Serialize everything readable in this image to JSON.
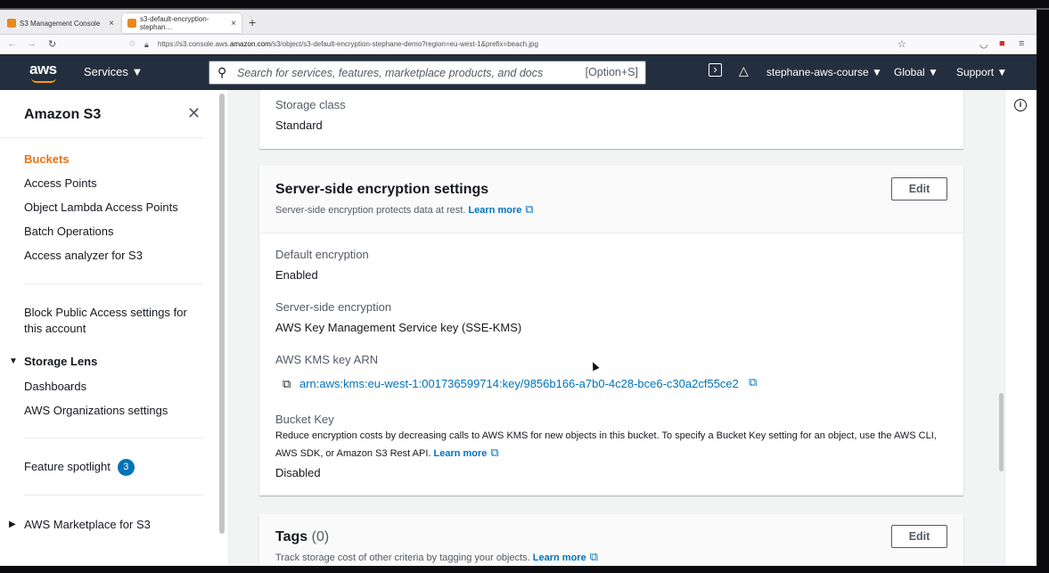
{
  "browser": {
    "tabs": [
      {
        "label": "S3 Management Console"
      },
      {
        "label": "s3-default-encryption-stephan…"
      }
    ],
    "url_prefix": "https://s3.console.aws.",
    "url_domain": "amazon.com",
    "url_suffix": "/s3/object/s3-default-encryption-stephane-demo?region=eu-west-1&prefix=beach.jpg"
  },
  "header": {
    "logo": "aws",
    "services": "Services ▼",
    "search_placeholder": "Search for services, features, marketplace products, and docs",
    "search_shortcut": "[Option+S]",
    "account": "stephane-aws-course ▼",
    "region": "Global ▼",
    "support": "Support ▼"
  },
  "sidebar": {
    "title": "Amazon S3",
    "items": [
      {
        "label": "Buckets"
      },
      {
        "label": "Access Points"
      },
      {
        "label": "Object Lambda Access Points"
      },
      {
        "label": "Batch Operations"
      },
      {
        "label": "Access analyzer for S3"
      },
      {
        "label": "Block Public Access settings for"
      },
      {
        "label": "this account"
      },
      {
        "label": "Storage Lens"
      },
      {
        "label": "Dashboards"
      },
      {
        "label": "AWS Organizations settings"
      },
      {
        "label": "Feature spotlight"
      },
      {
        "label": "AWS Marketplace for S3"
      }
    ],
    "badge": "3"
  },
  "storage": {
    "label": "Storage class",
    "value": "Standard"
  },
  "encryption": {
    "title": "Server-side encryption settings",
    "desc": "Server-side encryption protects data at rest.",
    "learn_more": "Learn more",
    "edit": "Edit",
    "default_label": "Default encryption",
    "default_value": "Enabled",
    "sse_label": "Server-side encryption",
    "sse_value": "AWS Key Management Service key (SSE-KMS)",
    "arn_label": "AWS KMS key ARN",
    "arn_value": "arn:aws:kms:eu-west-1:001736599714:key/9856b166-a7b0-4c28-bce6-c30a2cf55ce2",
    "bucket_key_label": "Bucket Key",
    "bucket_key_desc1": "Reduce encryption costs by decreasing calls to AWS KMS for new objects in this bucket. To specify a Bucket Key setting for an object, use the AWS CLI,",
    "bucket_key_desc2": "AWS SDK, or Amazon S3 Rest API.",
    "bucket_key_value": "Disabled"
  },
  "tags": {
    "title": "Tags",
    "count": "(0)",
    "desc": "Track storage cost of other criteria by tagging your objects.",
    "learn_more": "Learn more",
    "edit": "Edit"
  }
}
